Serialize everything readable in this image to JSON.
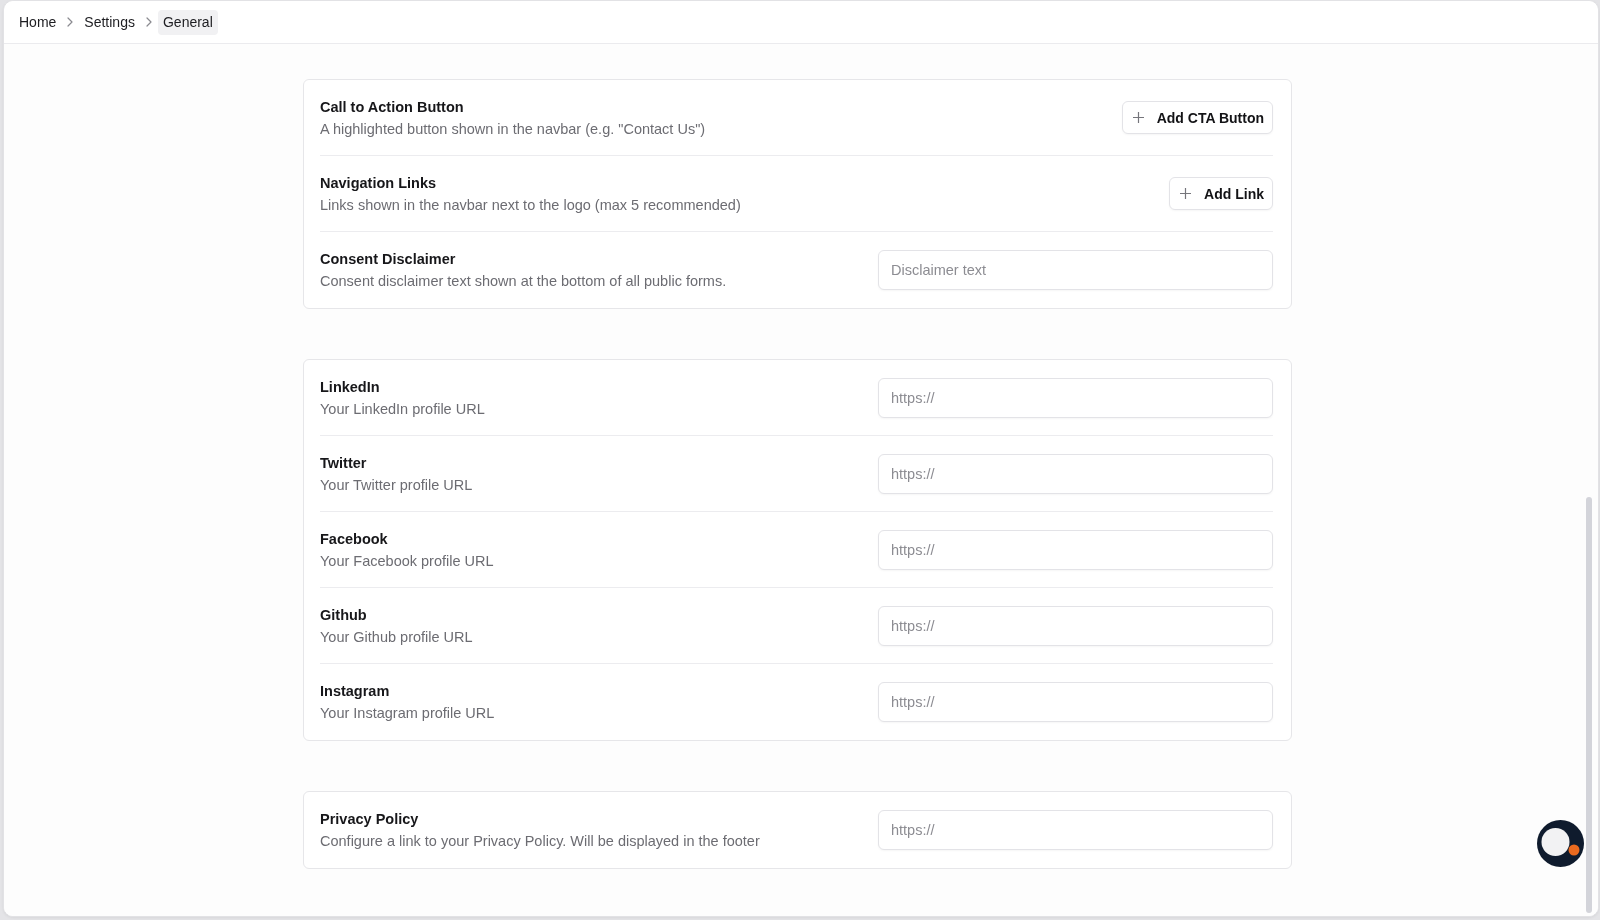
{
  "breadcrumb": [
    {
      "label": "Home",
      "selected": false
    },
    {
      "label": "Settings",
      "selected": false
    },
    {
      "label": "General",
      "selected": true
    }
  ],
  "sections": [
    {
      "rows": [
        {
          "kind": "button",
          "title": "Call to Action Button",
          "description": "A highlighted button shown in the navbar (e.g. \"Contact Us\")",
          "button_label": "Add CTA Button"
        },
        {
          "kind": "button",
          "title": "Navigation Links",
          "description": "Links shown in the navbar next to the logo (max 5 recommended)",
          "button_label": "Add Link"
        },
        {
          "kind": "input",
          "title": "Consent Disclaimer",
          "description": "Consent disclaimer text shown at the bottom of all public forms.",
          "placeholder": "Disclaimer text"
        }
      ]
    },
    {
      "rows": [
        {
          "kind": "input",
          "title": "LinkedIn",
          "description": "Your LinkedIn profile URL",
          "placeholder": "https://"
        },
        {
          "kind": "input",
          "title": "Twitter",
          "description": "Your Twitter profile URL",
          "placeholder": "https://"
        },
        {
          "kind": "input",
          "title": "Facebook",
          "description": "Your Facebook profile URL",
          "placeholder": "https://"
        },
        {
          "kind": "input",
          "title": "Github",
          "description": "Your Github profile URL",
          "placeholder": "https://"
        },
        {
          "kind": "input",
          "title": "Instagram",
          "description": "Your Instagram profile URL",
          "placeholder": "https://"
        }
      ]
    },
    {
      "rows": [
        {
          "kind": "input",
          "title": "Privacy Policy",
          "description": "Configure a link to your Privacy Policy. Will be displayed in the footer",
          "placeholder": "https://"
        }
      ]
    }
  ]
}
